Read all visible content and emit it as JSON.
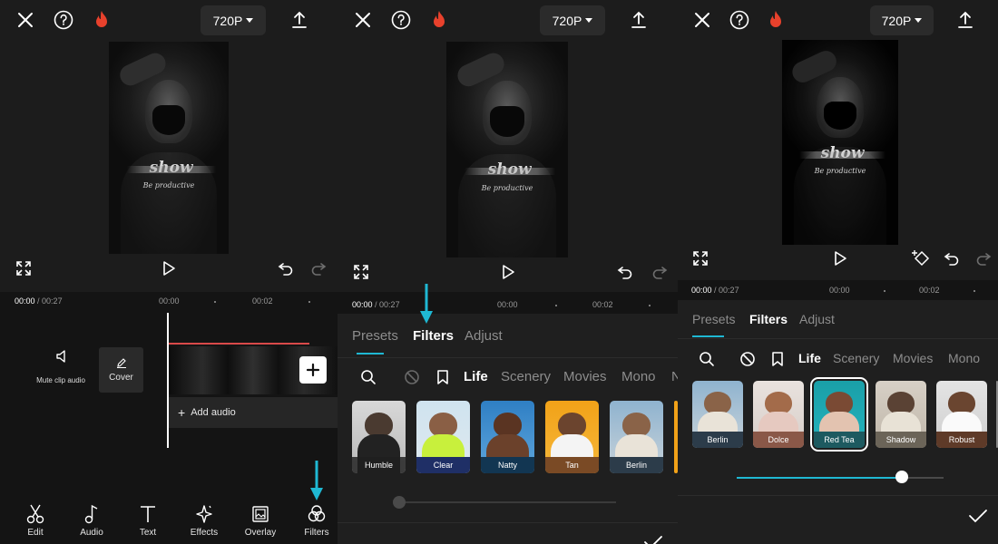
{
  "top": {
    "resolution": "720P"
  },
  "preview": {
    "overlay_title": "show",
    "overlay_subtitle": "Be productive"
  },
  "panel1": {
    "time_current": "00:00",
    "time_total": "/ 00:27",
    "ruler_ticks": [
      "00:00",
      "00:02"
    ],
    "mute_label": "Mute clip audio",
    "cover_label": "Cover",
    "add_audio_label": "Add audio",
    "toolbar": [
      {
        "label": "Edit",
        "icon": "scissors-icon"
      },
      {
        "label": "Audio",
        "icon": "music-note-icon"
      },
      {
        "label": "Text",
        "icon": "text-icon"
      },
      {
        "label": "Effects",
        "icon": "sparkle-star-icon"
      },
      {
        "label": "Overlay",
        "icon": "overlay-image-icon"
      },
      {
        "label": "Filters",
        "icon": "filters-circles-icon"
      }
    ]
  },
  "panel2": {
    "time_current": "00:00",
    "time_total": "/ 00:27",
    "ruler_ticks": [
      "00:00",
      "00:02"
    ],
    "tabs": [
      "Presets",
      "Filters",
      "Adjust"
    ],
    "categories": [
      "Life",
      "Scenery",
      "Movies",
      "Mono",
      "N"
    ],
    "filters": [
      "Humble",
      "Clear",
      "Natty",
      "Tan",
      "Berlin"
    ],
    "slider_value": 0
  },
  "panel3": {
    "time_current": "00:00",
    "time_total": "/ 00:27",
    "ruler_ticks": [
      "00:00",
      "00:02"
    ],
    "tabs": [
      "Presets",
      "Filters",
      "Adjust"
    ],
    "categories": [
      "Life",
      "Scenery",
      "Movies",
      "Mono"
    ],
    "filters": [
      "Berlin",
      "Dolce",
      "Red Tea",
      "Shadow",
      "Robust"
    ],
    "selected_filter": "Red Tea",
    "slider_value": 0.8
  },
  "colors": {
    "accent": "#1fb8d3",
    "fire": "#e8412c",
    "background": "#1c1c1c"
  }
}
